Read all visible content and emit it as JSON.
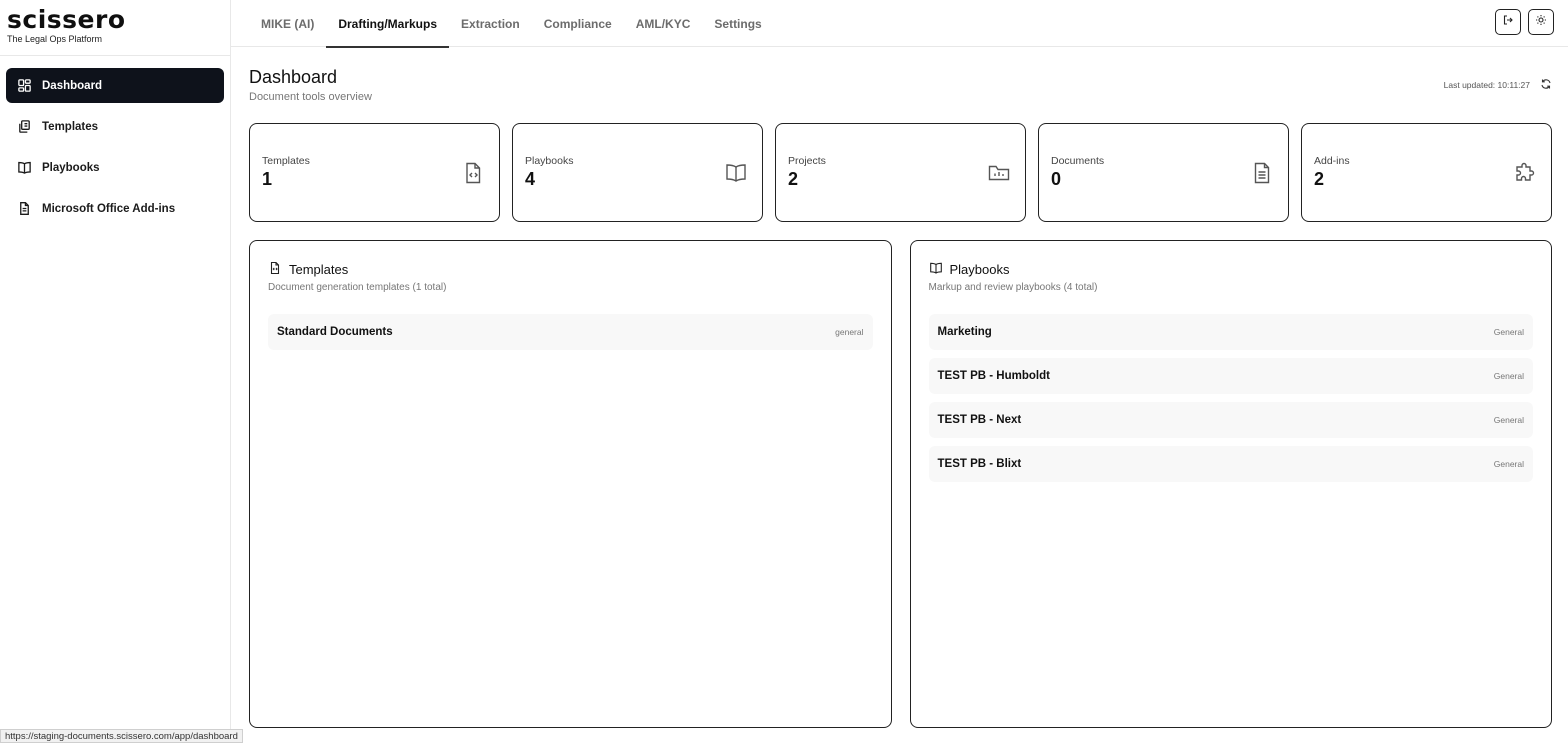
{
  "brand": {
    "logo": "scissero",
    "tagline": "The Legal Ops Platform"
  },
  "sidebar": {
    "items": [
      {
        "label": "Dashboard",
        "icon": "dashboard-grid-icon",
        "active": true
      },
      {
        "label": "Templates",
        "icon": "templates-icon",
        "active": false
      },
      {
        "label": "Playbooks",
        "icon": "book-icon",
        "active": false
      },
      {
        "label": "Microsoft Office Add-ins",
        "icon": "document-icon",
        "active": false
      }
    ]
  },
  "topnav": {
    "tabs": [
      {
        "label": "MIKE (AI)",
        "active": false
      },
      {
        "label": "Drafting/Markups",
        "active": true
      },
      {
        "label": "Extraction",
        "active": false
      },
      {
        "label": "Compliance",
        "active": false
      },
      {
        "label": "AML/KYC",
        "active": false
      },
      {
        "label": "Settings",
        "active": false
      }
    ],
    "actions": [
      "logout-icon",
      "sun-icon"
    ]
  },
  "page": {
    "title": "Dashboard",
    "subtitle": "Document tools overview",
    "last_updated": "Last updated: 10:11:27"
  },
  "stats": [
    {
      "label": "Templates",
      "value": "1",
      "icon": "code-file-icon"
    },
    {
      "label": "Playbooks",
      "value": "4",
      "icon": "book-icon"
    },
    {
      "label": "Projects",
      "value": "2",
      "icon": "folder-chart-icon"
    },
    {
      "label": "Documents",
      "value": "0",
      "icon": "document-icon"
    },
    {
      "label": "Add-ins",
      "value": "2",
      "icon": "puzzle-icon"
    }
  ],
  "templates_panel": {
    "title": "Templates",
    "subtitle": "Document generation templates (1 total)",
    "items": [
      {
        "name": "Standard Documents",
        "tag": "general"
      }
    ]
  },
  "playbooks_panel": {
    "title": "Playbooks",
    "subtitle": "Markup and review playbooks (4 total)",
    "items": [
      {
        "name": "Marketing",
        "tag": "General"
      },
      {
        "name": "TEST PB - Humboldt",
        "tag": "General"
      },
      {
        "name": "TEST PB - Next",
        "tag": "General"
      },
      {
        "name": "TEST PB - Blixt",
        "tag": "General"
      }
    ]
  },
  "statusbar": {
    "url": "https://staging-documents.scissero.com/app/dashboard"
  }
}
